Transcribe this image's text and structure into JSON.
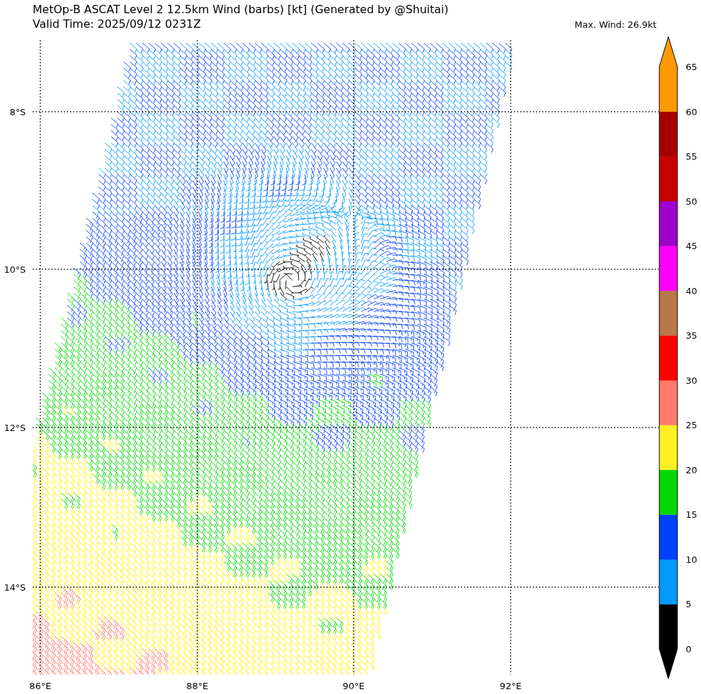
{
  "title": "MetOp-B ASCAT Level 2 12.5km Wind (barbs) [kt] (Generated by @Shuitai)",
  "valid_time": "Valid Time: 2025/09/12 0231Z",
  "max_wind": "Max. Wind: 26.9kt",
  "x_axis": {
    "ticks": [
      "86°E",
      "88°E",
      "90°E",
      "92°E"
    ]
  },
  "y_axis": {
    "ticks": [
      "8°S",
      "10°S",
      "12°S",
      "14°S"
    ]
  },
  "colorbar": {
    "ticks": [
      "65",
      "60",
      "55",
      "50",
      "45",
      "40",
      "35",
      "30",
      "25",
      "20",
      "15",
      "10",
      "5",
      "0"
    ],
    "segments": [
      {
        "kind": "under",
        "color": "#000000"
      },
      {
        "kind": "band",
        "color": "#000000"
      },
      {
        "kind": "band",
        "color": "#0099ff"
      },
      {
        "kind": "band",
        "color": "#0040ff"
      },
      {
        "kind": "band",
        "color": "#00d800"
      },
      {
        "kind": "band",
        "color": "#fff022"
      },
      {
        "kind": "band",
        "color": "#ff7a6a"
      },
      {
        "kind": "band",
        "color": "#ff0000"
      },
      {
        "kind": "band",
        "color": "#b87848"
      },
      {
        "kind": "band",
        "color": "#ff00ff"
      },
      {
        "kind": "band",
        "color": "#a000cc"
      },
      {
        "kind": "band",
        "color": "#c80000"
      },
      {
        "kind": "band",
        "color": "#a80000"
      },
      {
        "kind": "band",
        "color": "#ff9900"
      },
      {
        "kind": "over",
        "color": "#ff9900"
      }
    ]
  }
}
